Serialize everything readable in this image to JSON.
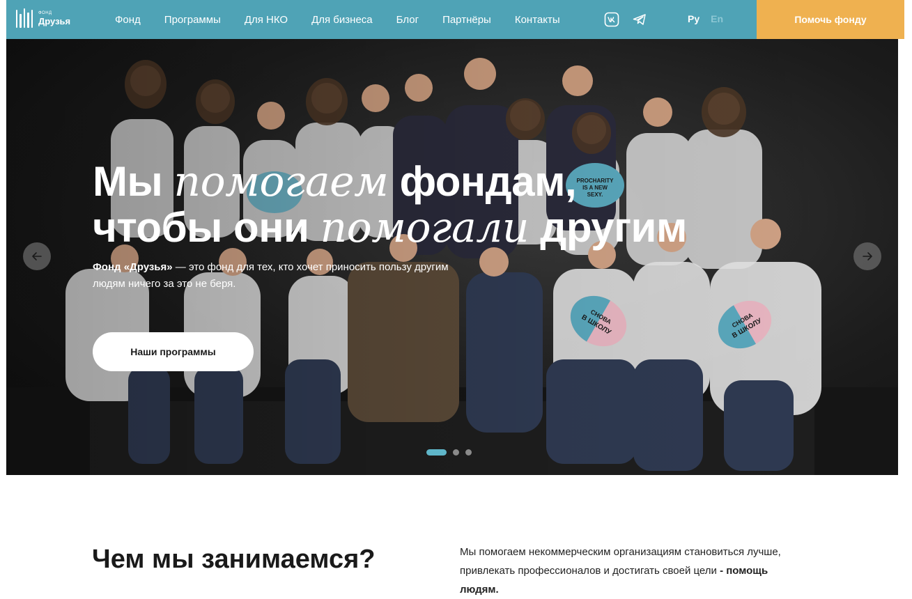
{
  "header": {
    "logo_small": "ФОНД",
    "logo_name": "Друзья",
    "nav": [
      "Фонд",
      "Программы",
      "Для НКО",
      "Для бизнеса",
      "Блог",
      "Партнёры",
      "Контакты"
    ],
    "social": [
      "vk-icon",
      "telegram-icon"
    ],
    "lang_active": "Ру",
    "lang_inactive": "En",
    "help_button": "Помочь фонду",
    "colors": {
      "bar": "#4fa3b6",
      "cta": "#efb150"
    }
  },
  "hero": {
    "title_line1_a": "Мы",
    "title_line1_em": "помогаем",
    "title_line1_b": "фондам,",
    "title_line2_a": "чтобы они",
    "title_line2_em": "помогали",
    "title_line2_b": "другим",
    "subtitle_bold": "Фонд «Друзья»",
    "subtitle_rest": " — это фонд для тех, кто хочет приносить пользу другим людям ничего за это не беря.",
    "button": "Наши программы",
    "photo_signs": [
      "PROCHARITY IS A NEW SEXY.",
      "СНОВА В ШКОЛУ",
      "СНОВА В ШКОЛУ"
    ],
    "slides_total": 3,
    "slide_active": 1
  },
  "about": {
    "title": "Чем мы занимаемся?",
    "text": "Мы помогаем некоммерческим организациям становиться лучше, привлекать профессионалов и достигать своей цели ",
    "text_bold": "- помощь людям."
  }
}
